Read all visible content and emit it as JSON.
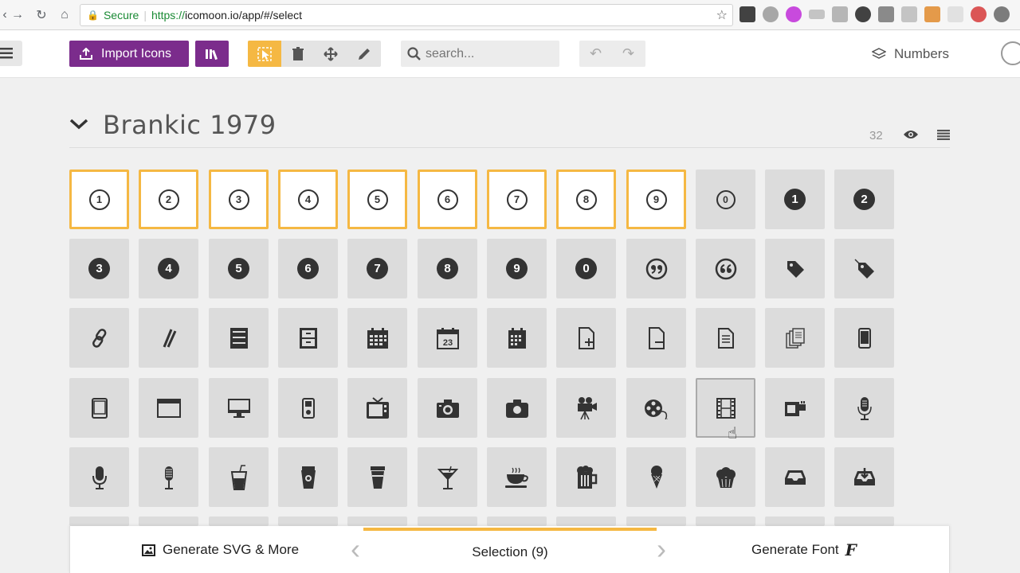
{
  "browser": {
    "secure_label": "Secure",
    "url_scheme": "https://",
    "url_rest": "icomoon.io/app/#/select"
  },
  "toolbar": {
    "import_label": "Import Icons",
    "search_placeholder": "search...",
    "numbers_label": "Numbers"
  },
  "set": {
    "title": "Brankic 1979",
    "count": "32"
  },
  "grid": {
    "rows": [
      [
        {
          "t": "outline",
          "v": "1",
          "sel": true
        },
        {
          "t": "outline",
          "v": "2",
          "sel": true
        },
        {
          "t": "outline",
          "v": "3",
          "sel": true
        },
        {
          "t": "outline",
          "v": "4",
          "sel": true
        },
        {
          "t": "outline",
          "v": "5",
          "sel": true
        },
        {
          "t": "outline",
          "v": "6",
          "sel": true
        },
        {
          "t": "outline",
          "v": "7",
          "sel": true
        },
        {
          "t": "outline",
          "v": "8",
          "sel": true
        },
        {
          "t": "outline",
          "v": "9",
          "sel": true
        },
        {
          "t": "outline",
          "v": "0",
          "sel": false
        },
        {
          "t": "filled",
          "v": "1",
          "sel": false
        },
        {
          "t": "filled",
          "v": "2",
          "sel": false
        }
      ],
      [
        {
          "t": "filled",
          "v": "3"
        },
        {
          "t": "filled",
          "v": "4"
        },
        {
          "t": "filled",
          "v": "5"
        },
        {
          "t": "filled",
          "v": "6"
        },
        {
          "t": "filled",
          "v": "7"
        },
        {
          "t": "filled",
          "v": "8"
        },
        {
          "t": "filled",
          "v": "9"
        },
        {
          "t": "filled",
          "v": "0"
        },
        {
          "t": "glyph",
          "g": "❞",
          "name": "quote-right-icon"
        },
        {
          "t": "glyph",
          "g": "❝",
          "name": "quote-left-icon"
        },
        {
          "t": "glyph",
          "g": "🏷",
          "name": "tag-icon"
        },
        {
          "t": "glyph",
          "g": "🏷",
          "name": "tag-icon"
        }
      ]
    ]
  },
  "bottom": {
    "svg_label": "Generate SVG & More",
    "selection_label": "Selection (9)",
    "font_label": "Generate Font",
    "font_glyph": "F"
  }
}
